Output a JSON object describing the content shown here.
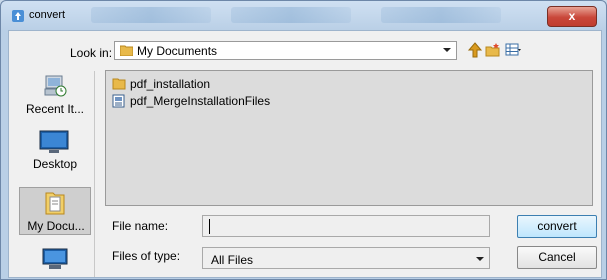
{
  "window": {
    "title": "convert",
    "close_label": "x"
  },
  "look_in": {
    "label": "Look in:",
    "value": "My Documents"
  },
  "places": [
    {
      "label": "Recent It...",
      "icon": "recent-items-icon"
    },
    {
      "label": "Desktop",
      "icon": "desktop-icon"
    },
    {
      "label": "My Docu...",
      "icon": "my-documents-icon"
    },
    {
      "label": "",
      "icon": "computer-icon"
    }
  ],
  "files": [
    {
      "name": "pdf_installation",
      "icon": "folder-icon"
    },
    {
      "name": "pdf_MergeInstallationFiles",
      "icon": "file-icon"
    }
  ],
  "file_name": {
    "label": "File name:",
    "value": ""
  },
  "file_type": {
    "label": "Files of type:",
    "value": "All Files"
  },
  "buttons": {
    "convert": "convert",
    "cancel": "Cancel"
  }
}
